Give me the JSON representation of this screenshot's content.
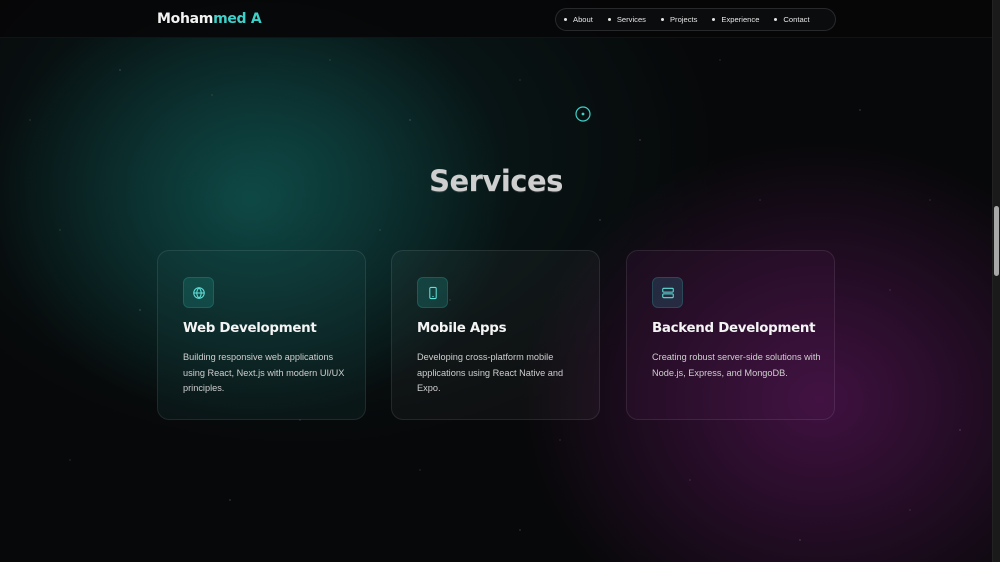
{
  "brand": {
    "first": "Moham",
    "second": "med A"
  },
  "nav": {
    "items": [
      {
        "label": "About"
      },
      {
        "label": "Services"
      },
      {
        "label": "Projects"
      },
      {
        "label": "Experience"
      },
      {
        "label": "Contact"
      }
    ]
  },
  "section": {
    "title": "Services"
  },
  "services": [
    {
      "icon": "globe-icon",
      "title": "Web Development",
      "description": "Building responsive web applications using React, Next.js with modern UI/UX principles."
    },
    {
      "icon": "smartphone-icon",
      "title": "Mobile Apps",
      "description": "Developing cross-platform mobile applications using React Native and Expo."
    },
    {
      "icon": "server-icon",
      "title": "Backend Development",
      "description": "Creating robust server-side solutions with Node.js, Express, and MongoDB."
    }
  ],
  "colors": {
    "accent": "#3fd0c9",
    "background": "#070809",
    "teal_glow": "#126e68",
    "purple_glow": "#6e186e"
  }
}
